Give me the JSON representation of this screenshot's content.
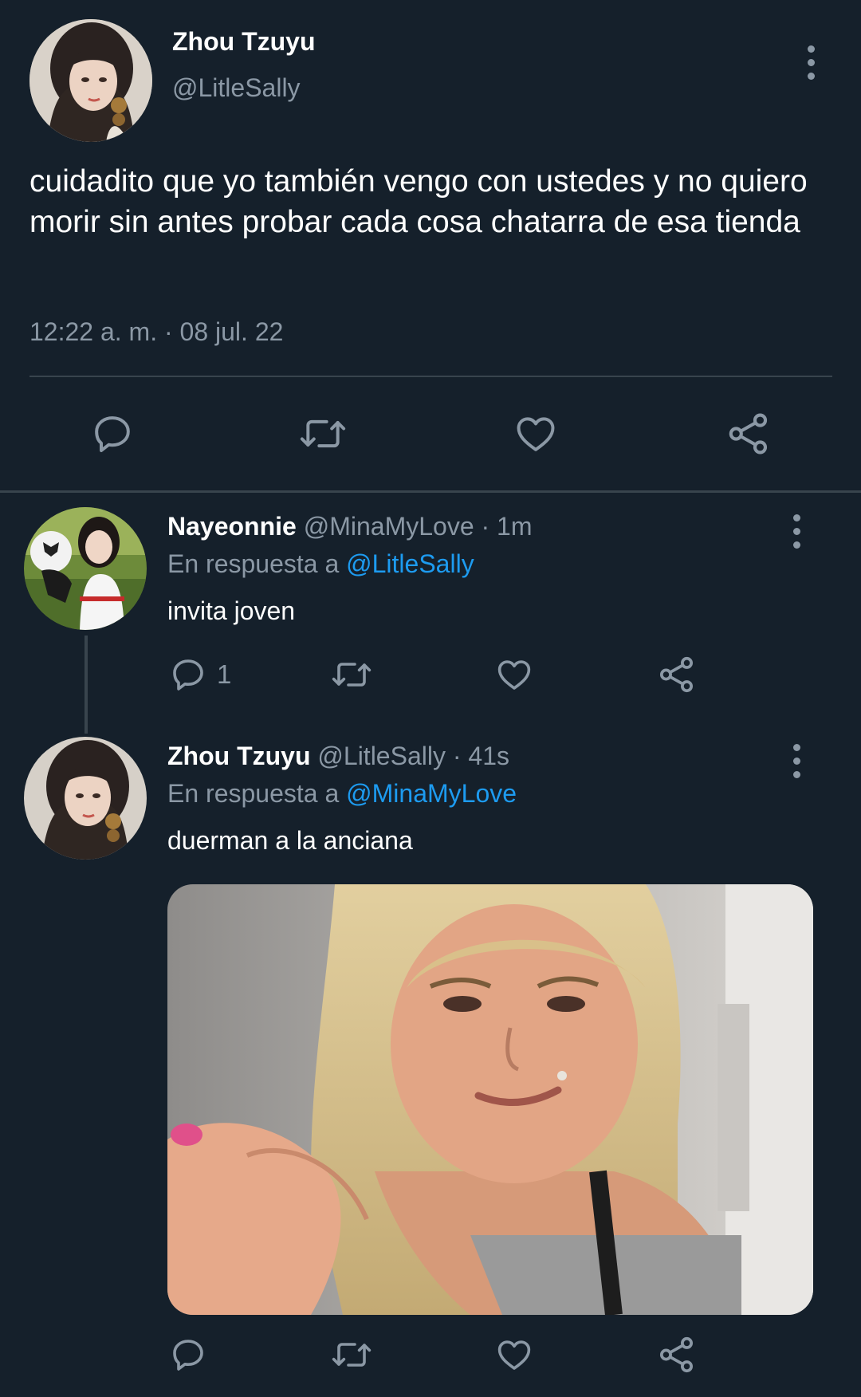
{
  "main_tweet": {
    "author_name": "Zhou Tzuyu",
    "author_handle": "@LitleSally",
    "text": "cuidadito que yo también vengo con ustedes y no quiero morir sin antes probar cada cosa chatarra de esa tienda",
    "timestamp": "12:22 a. m. · 08 jul. 22",
    "icons": [
      "reply-icon",
      "retweet-icon",
      "like-icon",
      "share-icon"
    ]
  },
  "replies": [
    {
      "author_name": "Nayeonnie",
      "author_handle": "@MinaMyLove",
      "time": "· 1m",
      "reply_prefix": "En respuesta a",
      "reply_to": "@LitleSally",
      "text": "invita joven",
      "reply_count": "1"
    },
    {
      "author_name": "Zhou Tzuyu",
      "author_handle": "@LitleSally",
      "time": "· 41s",
      "reply_prefix": "En respuesta a",
      "reply_to": "@MinaMyLove",
      "text": "duerman a la anciana"
    }
  ],
  "colors": {
    "background": "#15202b",
    "text": "#ffffff",
    "secondary": "#8b98a5",
    "link": "#1d9bf0",
    "divider": "#38444d"
  }
}
